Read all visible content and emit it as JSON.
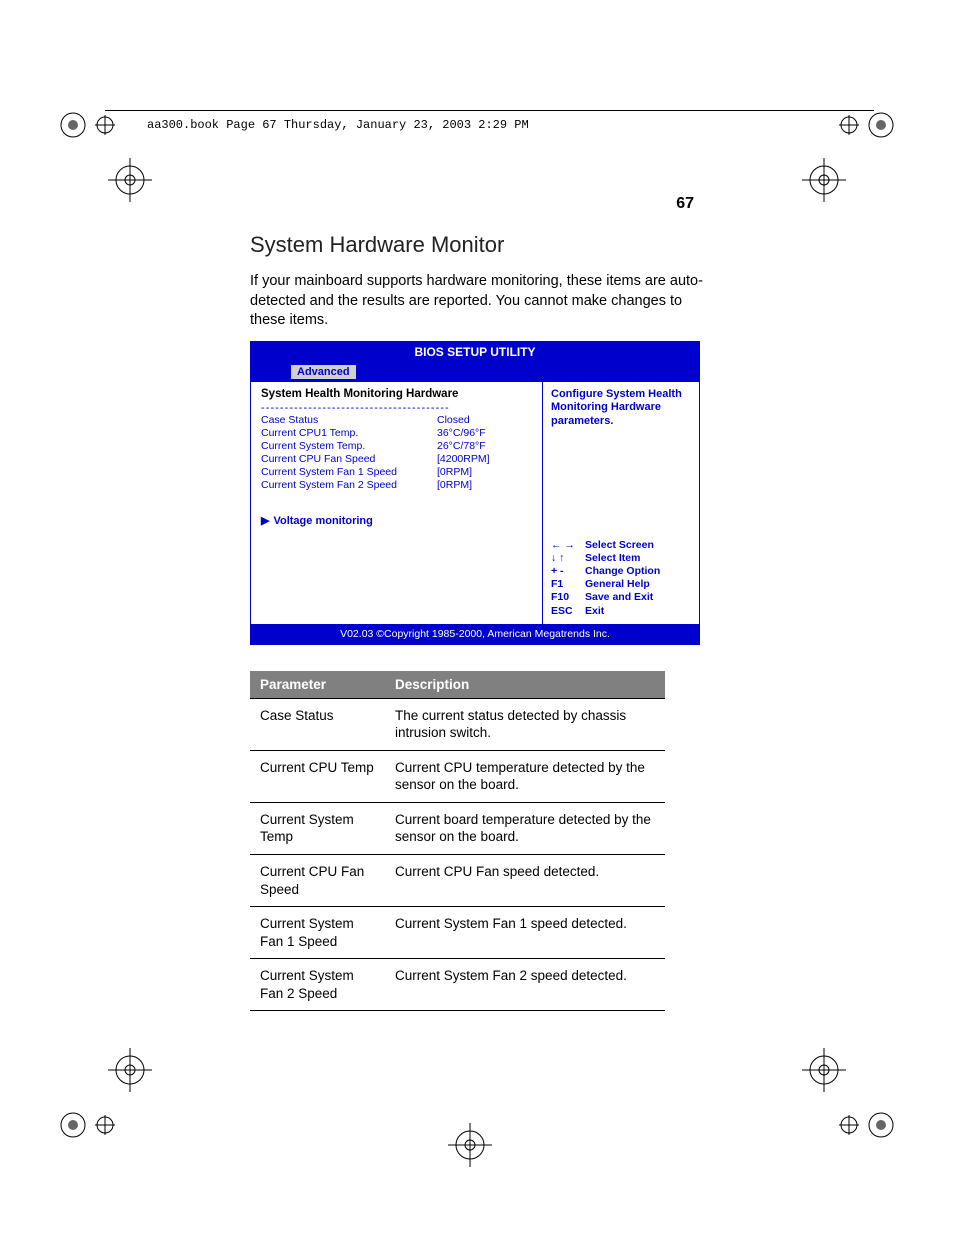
{
  "header_text": "aa300.book  Page 67  Thursday, January 23, 2003  2:29 PM",
  "page_number": "67",
  "section_title": "System Hardware Monitor",
  "intro_text": "If your mainboard supports hardware monitoring, these items are auto-detected and the results are reported. You cannot make changes to these items.",
  "bios": {
    "title": "BIOS SETUP UTILITY",
    "tab": "Advanced",
    "panel_title": "System Health Monitoring Hardware",
    "rows": [
      {
        "label": "Case Status",
        "value": "Closed"
      },
      {
        "label": "Current CPU1 Temp.",
        "value": "36°C/96°F"
      },
      {
        "label": "Current System Temp.",
        "value": "26°C/78°F"
      },
      {
        "label": "Current CPU Fan Speed",
        "value": "[4200RPM]"
      },
      {
        "label": "Current System Fan 1 Speed",
        "value": "[0RPM]"
      },
      {
        "label": "Current System Fan 2 Speed",
        "value": "[0RPM]"
      }
    ],
    "voltage_label": "Voltage monitoring",
    "help": "Configure System Health Monitoring Hardware parameters.",
    "nav": [
      {
        "key": "← →",
        "action": "Select Screen"
      },
      {
        "key": "↓ ↑",
        "action": "Select Item"
      },
      {
        "key": "+ -",
        "action": "Change Option"
      },
      {
        "key": "F1",
        "action": "General Help"
      },
      {
        "key": "F10",
        "action": "Save and Exit"
      },
      {
        "key": "ESC",
        "action": "Exit"
      }
    ],
    "footer": "V02.03 ©Copyright 1985-2000, American Megatrends Inc."
  },
  "table": {
    "head_param": "Parameter",
    "head_desc": "Description",
    "rows": [
      {
        "param": "Case Status",
        "desc": "The current status detected by chassis intrusion switch."
      },
      {
        "param": "Current CPU Temp",
        "desc": "Current CPU temperature detected by the sensor on the board."
      },
      {
        "param": "Current System Temp",
        "desc": "Current board temperature detected by the sensor on the board."
      },
      {
        "param": "Current CPU Fan Speed",
        "desc": "Current CPU Fan speed detected."
      },
      {
        "param": "Current System Fan 1 Speed",
        "desc": "Current System Fan 1 speed detected."
      },
      {
        "param": "Current System Fan 2 Speed",
        "desc": "Current System Fan 2 speed detected."
      }
    ]
  }
}
